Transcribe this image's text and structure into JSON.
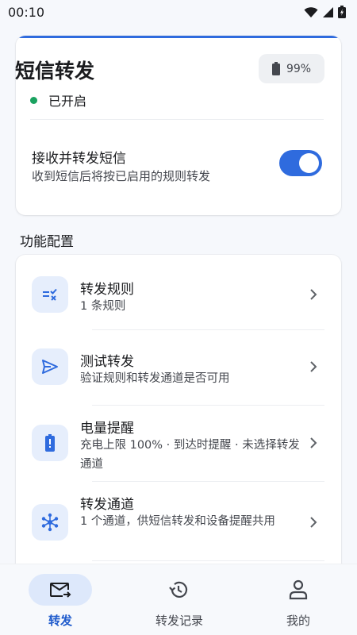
{
  "status_bar": {
    "time": "00:10"
  },
  "header": {
    "title": "短信转发",
    "battery_percent": "99%",
    "status_text": "已开启",
    "status_color": "#1aa260"
  },
  "toggle": {
    "title": "接收并转发短信",
    "subtitle": "收到短信后将按已启用的规则转发",
    "enabled": true,
    "accent": "#2f6bde"
  },
  "section": {
    "title": "功能配置"
  },
  "features": [
    {
      "icon": "rules-icon",
      "title": "转发规则",
      "subtitle": "1 条规则"
    },
    {
      "icon": "send-icon",
      "title": "测试转发",
      "subtitle": "验证规则和转发通道是否可用"
    },
    {
      "icon": "battery-alert-icon",
      "title": "电量提醒",
      "subtitle": "充电上限 100% · 到达时提醒 · 未选择转发通道"
    },
    {
      "icon": "network-hub-icon",
      "title": "转发通道",
      "subtitle": "1 个通道，供短信转发和设备提醒共用"
    }
  ],
  "nav": [
    {
      "icon": "forward-mail-icon",
      "label": "转发",
      "active": true
    },
    {
      "icon": "history-icon",
      "label": "转发记录",
      "active": false
    },
    {
      "icon": "person-icon",
      "label": "我的",
      "active": false
    }
  ]
}
